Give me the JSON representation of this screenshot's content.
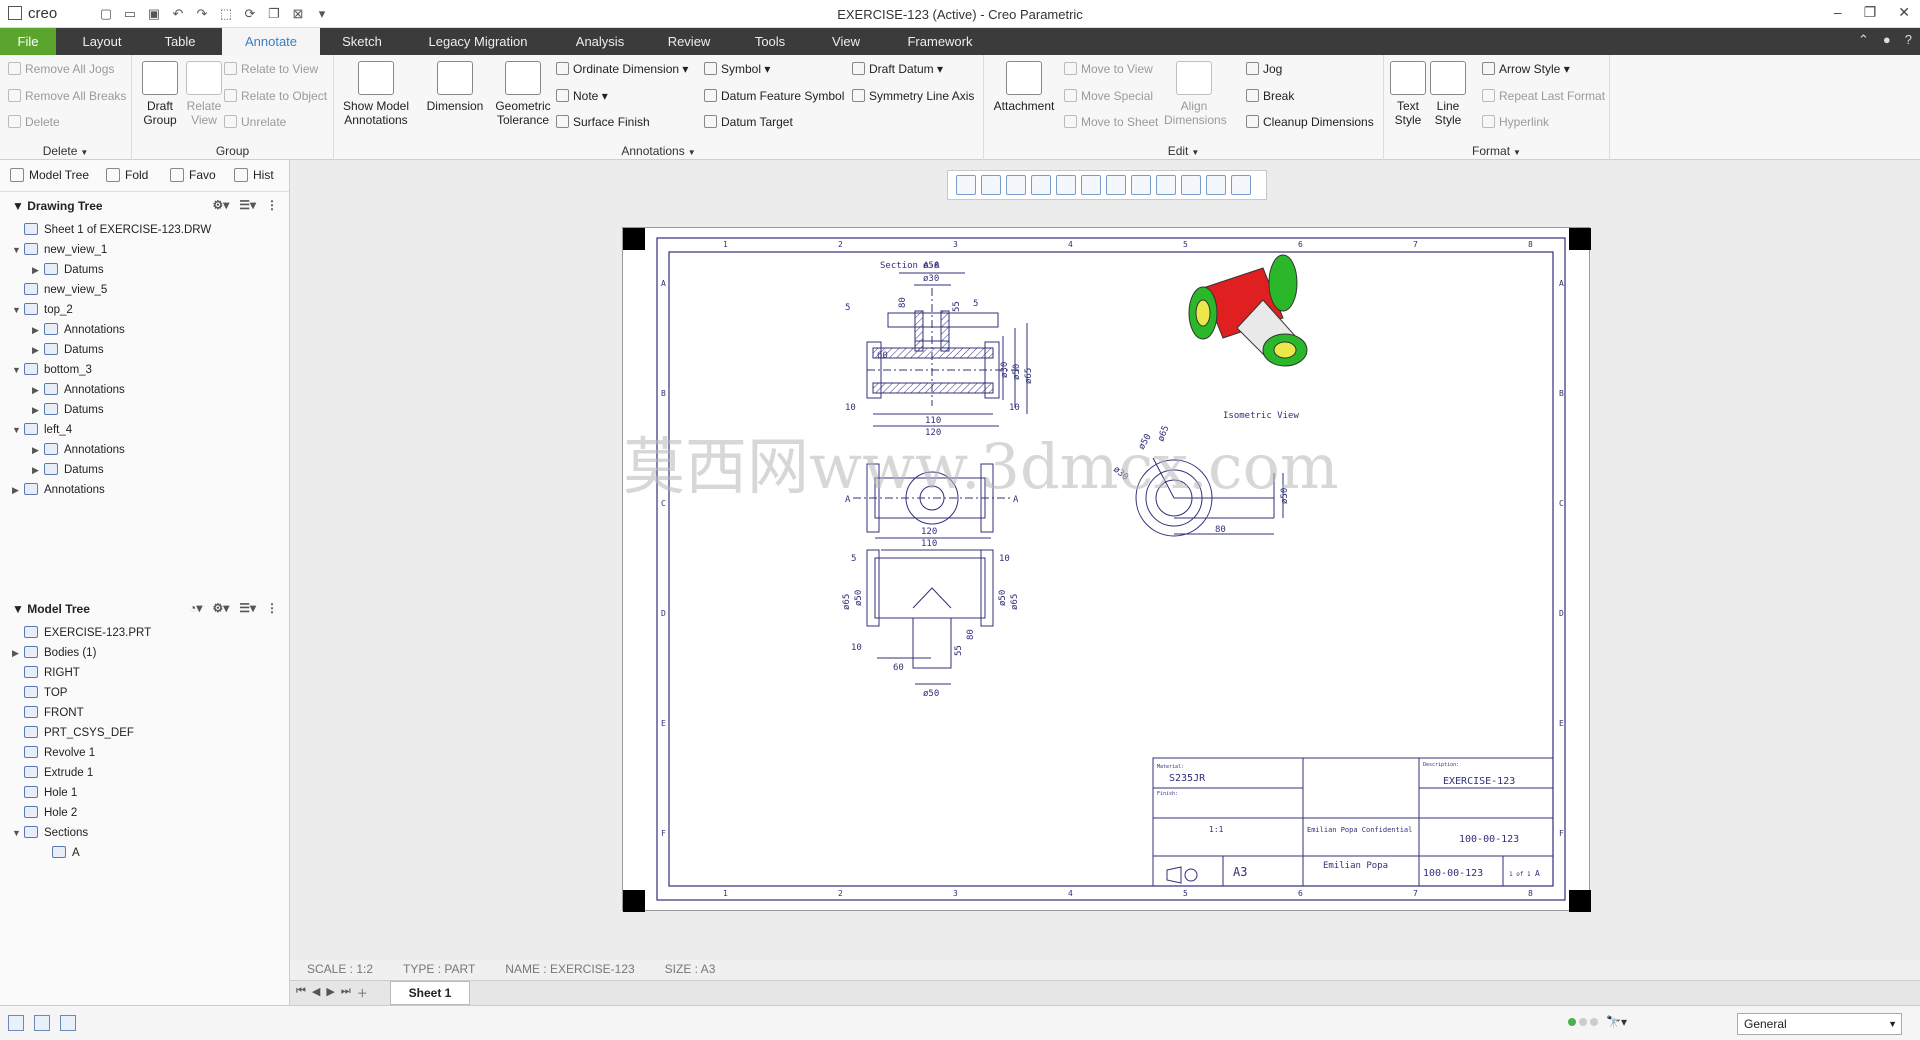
{
  "app": {
    "logo": "creo",
    "title": "EXERCISE-123 (Active) - Creo Parametric"
  },
  "tabs": [
    "File",
    "Layout",
    "Table",
    "Annotate",
    "Sketch",
    "Legacy Migration",
    "Analysis",
    "Review",
    "Tools",
    "View",
    "Framework"
  ],
  "ribbon": {
    "delete_group": {
      "label": "Delete",
      "items": [
        "Remove All Jogs",
        "Remove All Breaks",
        "Delete"
      ]
    },
    "group_group": {
      "label": "Group",
      "buttons": [
        "Draft\nGroup",
        "Relate\nView"
      ],
      "items": [
        "Relate to View",
        "Relate to Object",
        "Unrelate"
      ]
    },
    "annotations_group": {
      "label": "Annotations",
      "buttons": [
        "Show Model\nAnnotations",
        "Dimension",
        "Geometric\nTolerance"
      ],
      "items": [
        "Ordinate Dimension",
        "Note",
        "Surface Finish",
        "Symbol",
        "Datum Feature Symbol",
        "Datum Target",
        "Draft Datum",
        "Symmetry Line Axis"
      ]
    },
    "attachment": "Attachment",
    "edit_group": {
      "label": "Edit",
      "items": [
        "Move to View",
        "Move Special",
        "Move to Sheet"
      ],
      "align": "Align\nDimensions",
      "items2": [
        "Jog",
        "Break",
        "Cleanup Dimensions"
      ]
    },
    "format_group": {
      "label": "Format",
      "buttons": [
        "Text\nStyle",
        "Line\nStyle"
      ],
      "items": [
        "Arrow Style",
        "Repeat Last Format",
        "Hyperlink"
      ]
    }
  },
  "panel_tabs": [
    "Model Tree",
    "Fold",
    "Favo",
    "Hist"
  ],
  "drawing_tree": {
    "header": "Drawing Tree",
    "rows": [
      "Sheet 1 of EXERCISE-123.DRW",
      "new_view_1",
      "Datums",
      "new_view_5",
      "top_2",
      "Annotations",
      "Datums",
      "bottom_3",
      "Annotations",
      "Datums",
      "left_4",
      "Annotations",
      "Datums",
      "Annotations"
    ]
  },
  "model_tree": {
    "header": "Model Tree",
    "rows": [
      "EXERCISE-123.PRT",
      "Bodies (1)",
      "RIGHT",
      "TOP",
      "FRONT",
      "PRT_CSYS_DEF",
      "Revolve 1",
      "Extrude 1",
      "Hole 1",
      "Hole 2",
      "Sections",
      "A"
    ]
  },
  "status": {
    "scale": "SCALE : 1:2",
    "type": "TYPE : PART",
    "name": "NAME : EXERCISE-123",
    "size": "SIZE : A3"
  },
  "sheet_tab": "Sheet 1",
  "filter": "General",
  "drawing": {
    "section_label": "Section A-A",
    "iso_label": "Isometric View",
    "watermark": "莫西网www.3dmcx.com",
    "zones_top": [
      "1",
      "2",
      "3",
      "4",
      "5",
      "6",
      "7",
      "8"
    ],
    "zones_side": [
      "A",
      "B",
      "C",
      "D",
      "E",
      "F"
    ],
    "dims_section": [
      "ø50",
      "ø30",
      "80",
      "55",
      "5",
      "5",
      "60",
      "ø30",
      "ø50",
      "ø65",
      "10",
      "10",
      "110",
      "120"
    ],
    "dims_front": [
      "120",
      "110",
      "5",
      "10",
      "ø65",
      "ø50",
      "10",
      "ø50",
      "ø65",
      "55",
      "80",
      "60",
      "ø50"
    ],
    "dims_side": [
      "ø65",
      "ø50",
      "ø30",
      "ø50",
      "80"
    ],
    "section_marks": [
      "A",
      "A"
    ],
    "titleblock": {
      "material_label": "Material:",
      "material": "S235JR",
      "finish_label": "Finish:",
      "desc_label": "Description:",
      "description": "EXERCISE-123",
      "drawing_scale": "1:1",
      "sheet_size": "A3",
      "company": "Emilian Popa Confidential",
      "author": "Emilian Popa",
      "part_number": "100-00-123",
      "drawing_number": "100-00-123",
      "sheet": "1 of 1",
      "revision": "A"
    }
  }
}
